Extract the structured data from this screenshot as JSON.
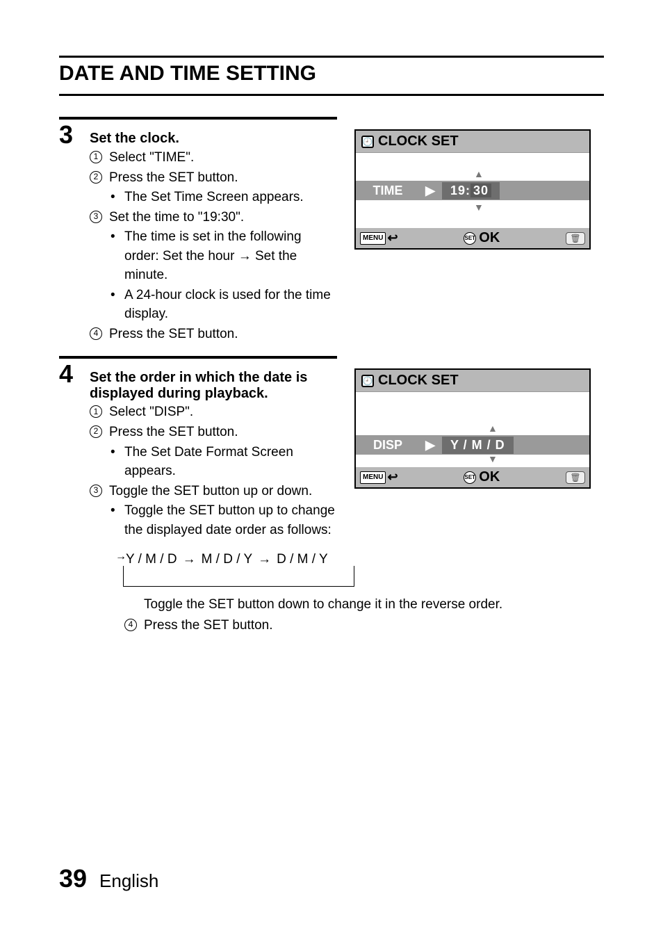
{
  "page": {
    "title": "DATE AND TIME SETTING",
    "number": "39",
    "language": "English"
  },
  "step3": {
    "number": "3",
    "title": "Set the clock.",
    "items": [
      {
        "n": "1",
        "text": "Select \"TIME\"."
      },
      {
        "n": "2",
        "text": "Press the SET button."
      },
      {
        "n": "3",
        "text": "Set the time to \"19:30\"."
      },
      {
        "n": "4",
        "text": "Press the SET button."
      }
    ],
    "bullets2": [
      "The Set Time Screen appears."
    ],
    "bullets3": [
      "The time is set in the following order: Set the hour → Set the minute.",
      "A 24-hour clock is used for the time display."
    ],
    "lcd": {
      "title": "CLOCK SET",
      "label": "TIME",
      "value": "19:30",
      "menu": "MENU",
      "set": "SET",
      "ok": "OK"
    }
  },
  "step4": {
    "number": "4",
    "title": "Set the order in which the date is displayed during playback.",
    "items": [
      {
        "n": "1",
        "text": "Select \"DISP\"."
      },
      {
        "n": "2",
        "text": "Press the SET button."
      },
      {
        "n": "3",
        "text": "Toggle the SET button up or down."
      },
      {
        "n": "4",
        "text": "Press the SET button."
      }
    ],
    "bullets2": [
      "The Set Date Format Screen appears."
    ],
    "bullets3": [
      "Toggle the SET button up to change the displayed date order as follows:"
    ],
    "cycle": {
      "a": "Y / M / D",
      "b": "M / D / Y",
      "c": "D / M / Y"
    },
    "reverse_text": "Toggle the SET button down to change it in the reverse order.",
    "lcd": {
      "title": "CLOCK SET",
      "label": "DISP",
      "value": "Y / M / D",
      "menu": "MENU",
      "set": "SET",
      "ok": "OK"
    }
  }
}
